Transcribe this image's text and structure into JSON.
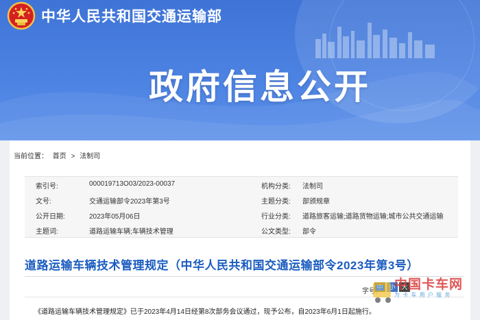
{
  "header": {
    "ministry_name": "中华人民共和国交通运输部",
    "banner_title": "政府信息公开"
  },
  "breadcrumb": {
    "label": "当前位置：",
    "home": "首页",
    "separator": ">",
    "current": "法制司"
  },
  "meta": {
    "rows": [
      {
        "k1": "索引号:",
        "v1": "000019713O03/2023-00037",
        "k2": "机构分类:",
        "v2": "法制司"
      },
      {
        "k1": "文号:",
        "v1": "交通运输部令2023年第3号",
        "k2": "主题分类:",
        "v2": "部颁规章"
      },
      {
        "k1": "公开日期:",
        "v1": "2023年05月06日",
        "k2": "行业分类:",
        "v2": "道路旅客运输;道路货物运输;城市公共交通运输"
      },
      {
        "k1": "主题词:",
        "v1": "道路运输车辆;车辆技术管理",
        "k2": "公文类型:",
        "v2": "部令"
      }
    ]
  },
  "document": {
    "title": "道路运输车辆技术管理规定（中华人民共和国交通运输部令2023年第3号）",
    "font_size_label": "字号:",
    "size_buttons": [
      "中",
      "小",
      "大"
    ],
    "body_first_line": "《道路运输车辆技术管理规定》已于2023年4月14日经第8次部务会议通过，现予公布，自2023年6月1日起施行。"
  },
  "watermark": {
    "logo_text": "中国卡车网",
    "sub_text": "为 卡 车 用 户 服 务"
  },
  "colors": {
    "banner_blue": "#4a7fe0",
    "title_blue": "#1a5cc0",
    "emblem_red": "#d42020"
  }
}
